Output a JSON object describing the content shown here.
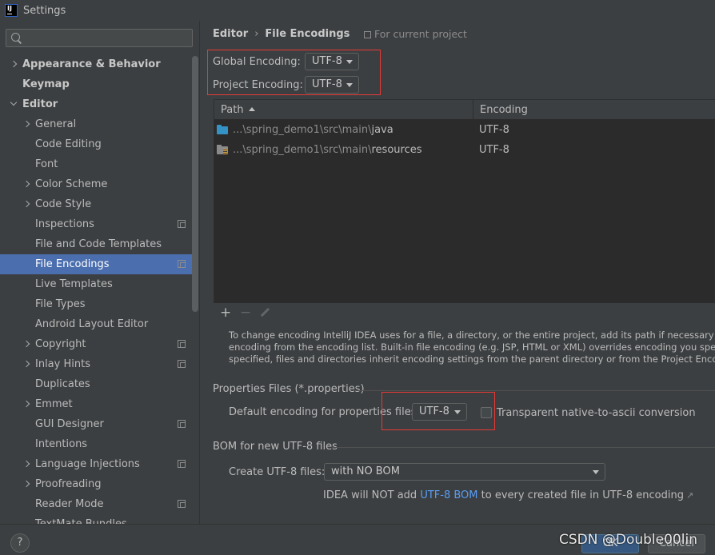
{
  "window": {
    "title": "Settings"
  },
  "sidebar": {
    "search_placeholder": "",
    "items": [
      {
        "label": "Appearance & Behavior"
      },
      {
        "label": "Keymap"
      },
      {
        "label": "Editor"
      },
      {
        "label": "General"
      },
      {
        "label": "Code Editing"
      },
      {
        "label": "Font"
      },
      {
        "label": "Color Scheme"
      },
      {
        "label": "Code Style"
      },
      {
        "label": "Inspections"
      },
      {
        "label": "File and Code Templates"
      },
      {
        "label": "File Encodings"
      },
      {
        "label": "Live Templates"
      },
      {
        "label": "File Types"
      },
      {
        "label": "Android Layout Editor"
      },
      {
        "label": "Copyright"
      },
      {
        "label": "Inlay Hints"
      },
      {
        "label": "Duplicates"
      },
      {
        "label": "Emmet"
      },
      {
        "label": "GUI Designer"
      },
      {
        "label": "Intentions"
      },
      {
        "label": "Language Injections"
      },
      {
        "label": "Proofreading"
      },
      {
        "label": "Reader Mode"
      },
      {
        "label": "TextMate Bundles"
      }
    ]
  },
  "main": {
    "breadcrumb": {
      "parent": "Editor",
      "separator": "›",
      "current": "File Encodings"
    },
    "scope_note": "For current project",
    "global_encoding": {
      "label": "Global Encoding:",
      "value": "UTF-8"
    },
    "project_encoding": {
      "label": "Project Encoding:",
      "value": "UTF-8"
    },
    "table": {
      "columns": [
        "Path",
        "Encoding"
      ],
      "rows": [
        {
          "path_prefix": "...\\spring_demo1\\src\\main\\",
          "path_last": "java",
          "encoding": "UTF-8"
        },
        {
          "path_prefix": "...\\spring_demo1\\src\\main\\",
          "path_last": "resources",
          "encoding": "UTF-8"
        }
      ],
      "toolbar": {
        "add": "+",
        "remove": "−"
      }
    },
    "help_lines": [
      "To change encoding IntelliJ IDEA uses for a file, a directory, or the entire project, add its path if necessary and then se",
      "encoding from the encoding list. Built-in file encoding (e.g. JSP, HTML or XML) overrides encoding you specify here",
      "specified, files and directories inherit encoding settings from the parent directory or from the Project Encoding."
    ],
    "properties": {
      "section_title": "Properties Files (*.properties)",
      "default_label": "Default encoding for properties files:",
      "default_value": "UTF-8",
      "native_ascii_label": "Transparent native-to-ascii conversion"
    },
    "bom": {
      "section_title": "BOM for new UTF-8 files",
      "create_label": "Create UTF-8 files:",
      "create_value": "with NO BOM",
      "note_before": "IDEA will NOT add ",
      "note_link": "UTF-8 BOM",
      "note_after": " to every created file in UTF-8 encoding",
      "note_arrow": "↗"
    }
  },
  "footer": {
    "help": "?",
    "ok": "OK",
    "cancel": "Cancel",
    "watermark": "CSDN @Double00lin"
  }
}
